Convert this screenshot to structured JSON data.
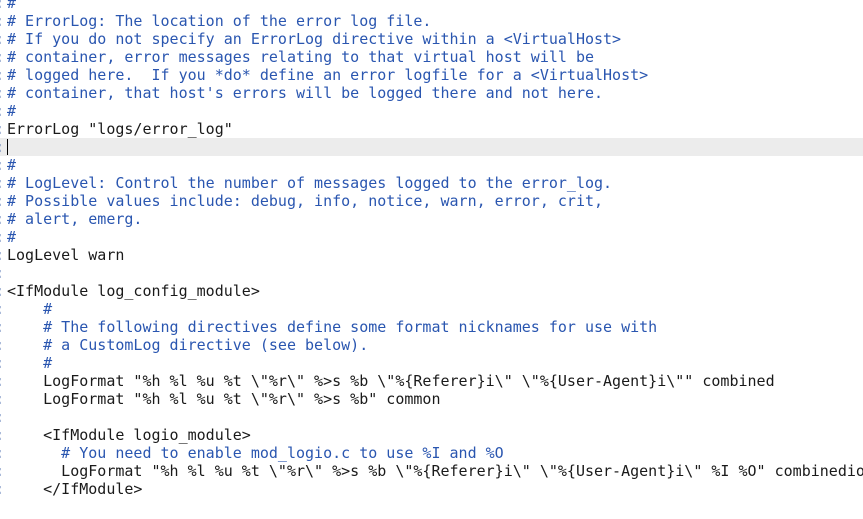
{
  "editor": {
    "gutter_marker": ":",
    "colors": {
      "comment": "#2a56b0",
      "text": "#1a1a1a",
      "current_line": "#ececec",
      "background": "#ffffff"
    },
    "lines": [
      {
        "text": "#",
        "type": "comment"
      },
      {
        "text": "# ErrorLog: The location of the error log file.",
        "type": "comment"
      },
      {
        "text": "# If you do not specify an ErrorLog directive within a <VirtualHost>",
        "type": "comment"
      },
      {
        "text": "# container, error messages relating to that virtual host will be",
        "type": "comment"
      },
      {
        "text": "# logged here.  If you *do* define an error logfile for a <VirtualHost>",
        "type": "comment"
      },
      {
        "text": "# container, that host's errors will be logged there and not here.",
        "type": "comment"
      },
      {
        "text": "#",
        "type": "comment"
      },
      {
        "text": "ErrorLog \"logs/error_log\"",
        "type": "directive"
      },
      {
        "text": "",
        "type": "current"
      },
      {
        "text": "#",
        "type": "comment"
      },
      {
        "text": "# LogLevel: Control the number of messages logged to the error_log.",
        "type": "comment"
      },
      {
        "text": "# Possible values include: debug, info, notice, warn, error, crit,",
        "type": "comment"
      },
      {
        "text": "# alert, emerg.",
        "type": "comment"
      },
      {
        "text": "#",
        "type": "comment"
      },
      {
        "text": "LogLevel warn",
        "type": "directive"
      },
      {
        "text": "",
        "type": "blank"
      },
      {
        "text": "<IfModule log_config_module>",
        "type": "directive"
      },
      {
        "text": "    #",
        "type": "comment"
      },
      {
        "text": "    # The following directives define some format nicknames for use with",
        "type": "comment"
      },
      {
        "text": "    # a CustomLog directive (see below).",
        "type": "comment"
      },
      {
        "text": "    #",
        "type": "comment"
      },
      {
        "text": "    LogFormat \"%h %l %u %t \\\"%r\\\" %>s %b \\\"%{Referer}i\\\" \\\"%{User-Agent}i\\\"\" combined",
        "type": "directive"
      },
      {
        "text": "    LogFormat \"%h %l %u %t \\\"%r\\\" %>s %b\" common",
        "type": "directive"
      },
      {
        "text": "",
        "type": "blank"
      },
      {
        "text": "    <IfModule logio_module>",
        "type": "directive"
      },
      {
        "text": "      # You need to enable mod_logio.c to use %I and %O",
        "type": "comment"
      },
      {
        "text": "      LogFormat \"%h %l %u %t \\\"%r\\\" %>s %b \\\"%{Referer}i\\\" \\\"%{User-Agent}i\\\" %I %O\" combinedio",
        "type": "directive"
      },
      {
        "text": "    </IfModule>",
        "type": "directive"
      }
    ]
  }
}
